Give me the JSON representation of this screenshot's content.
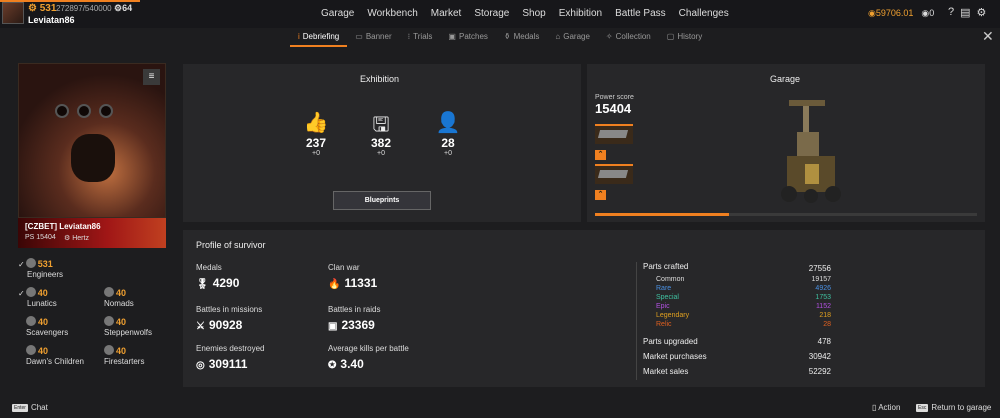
{
  "player": {
    "level": "531",
    "xp": "272897/540000",
    "badge_count": "64",
    "username": "Leviatan86"
  },
  "nav": [
    "Garage",
    "Workbench",
    "Market",
    "Storage",
    "Shop",
    "Exhibition",
    "Battle Pass",
    "Challenges"
  ],
  "currency": {
    "coins": "59706.01",
    "tokens": "0"
  },
  "tabs": [
    "Debriefing",
    "Banner",
    "Trials",
    "Patches",
    "Medals",
    "Garage",
    "Collection",
    "History"
  ],
  "profile_card": {
    "name": "[CZBET] Leviatan86",
    "ps": "PS 15404",
    "clan": "Hertz"
  },
  "factions": [
    {
      "level": "531",
      "name": "Engineers",
      "checked": true
    },
    {
      "level": "40",
      "name": "Lunatics",
      "checked": true
    },
    {
      "level": "40",
      "name": "Nomads",
      "checked": false
    },
    {
      "level": "40",
      "name": "Scavengers",
      "checked": false
    },
    {
      "level": "40",
      "name": "Steppenwolfs",
      "checked": false
    },
    {
      "level": "40",
      "name": "Dawn's Children",
      "checked": false
    },
    {
      "level": "40",
      "name": "Firestarters",
      "checked": false
    }
  ],
  "exhibition": {
    "title": "Exhibition",
    "stats": [
      {
        "icon": "thumbs-up-icon",
        "value": "237",
        "delta": "+0"
      },
      {
        "icon": "save-icon",
        "value": "382",
        "delta": "+0"
      },
      {
        "icon": "user-check-icon",
        "value": "28",
        "delta": "+0"
      }
    ],
    "blueprints_label": "Blueprints"
  },
  "garage": {
    "title": "Garage",
    "power_label": "Power score",
    "power_value": "15404",
    "progress": 0.35
  },
  "survivor": {
    "title": "Profile of survivor",
    "medals_label": "Medals",
    "medals": "4290",
    "clan_war_label": "Clan war",
    "clan_war": "11331",
    "missions_label": "Battles in missions",
    "missions": "90928",
    "raids_label": "Battles in raids",
    "raids": "23369",
    "enemies_label": "Enemies destroyed",
    "enemies": "309111",
    "kills_label": "Average kills per battle",
    "kills": "3.40"
  },
  "parts": {
    "crafted_label": "Parts crafted",
    "crafted": "27556",
    "rarities": [
      {
        "label": "Common",
        "value": "19157",
        "color": "#dddddd"
      },
      {
        "label": "Rare",
        "value": "4926",
        "color": "#4a90e2"
      },
      {
        "label": "Special",
        "value": "1753",
        "color": "#3fc0a0"
      },
      {
        "label": "Epic",
        "value": "1152",
        "color": "#b050e0"
      },
      {
        "label": "Legendary",
        "value": "218",
        "color": "#e0a020"
      },
      {
        "label": "Relic",
        "value": "28",
        "color": "#e06020"
      }
    ],
    "upgraded_label": "Parts upgraded",
    "upgraded": "478",
    "purchases_label": "Market purchases",
    "purchases": "30942",
    "sales_label": "Market sales",
    "sales": "52292"
  },
  "bottom": {
    "chat_key": "Enter",
    "chat": "Chat",
    "action": "Action",
    "return_key": "Esc",
    "return": "Return to garage"
  }
}
